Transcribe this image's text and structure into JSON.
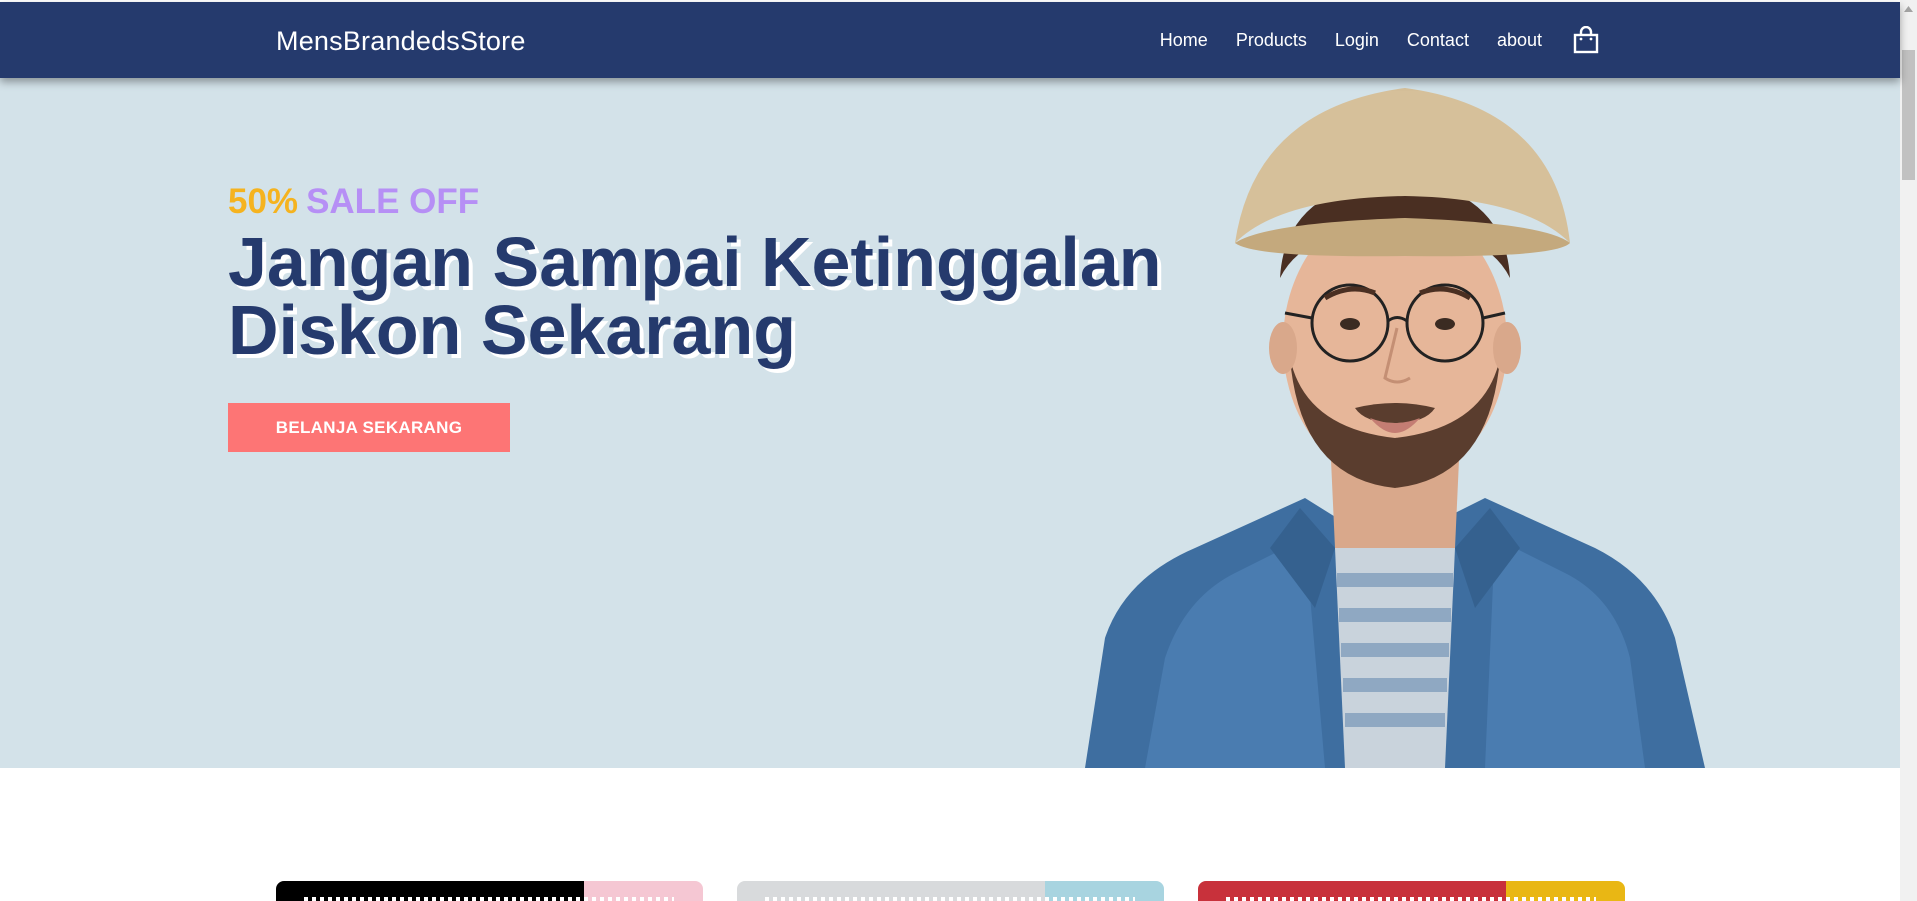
{
  "navbar": {
    "brand": "MensBrandedsStore",
    "links": [
      "Home",
      "Products",
      "Login",
      "Contact",
      "about"
    ],
    "cart_icon": "shopping-bag-icon"
  },
  "hero": {
    "promo_percent": "50%",
    "promo_text": "SALE OFF",
    "title_line1": "Jangan Sampai Ketinggalan",
    "title_line2": "Diskon Sekarang",
    "cta_label": "BELANJA SEKARANG"
  },
  "colors": {
    "navbar_bg": "#253a6d",
    "hero_bg": "#d3e2e9",
    "promo_percent": "#f5b31f",
    "promo_text": "#b68ff5",
    "title": "#253a6d",
    "cta_bg": "#fd7575"
  },
  "product_cards": [
    {
      "left_color": "#000000",
      "right_color": "#f5c7d3"
    },
    {
      "left_color": "#d8dadc",
      "right_color": "#a8d4e0"
    },
    {
      "left_color": "#c8313b",
      "right_color": "#e9b714"
    }
  ]
}
